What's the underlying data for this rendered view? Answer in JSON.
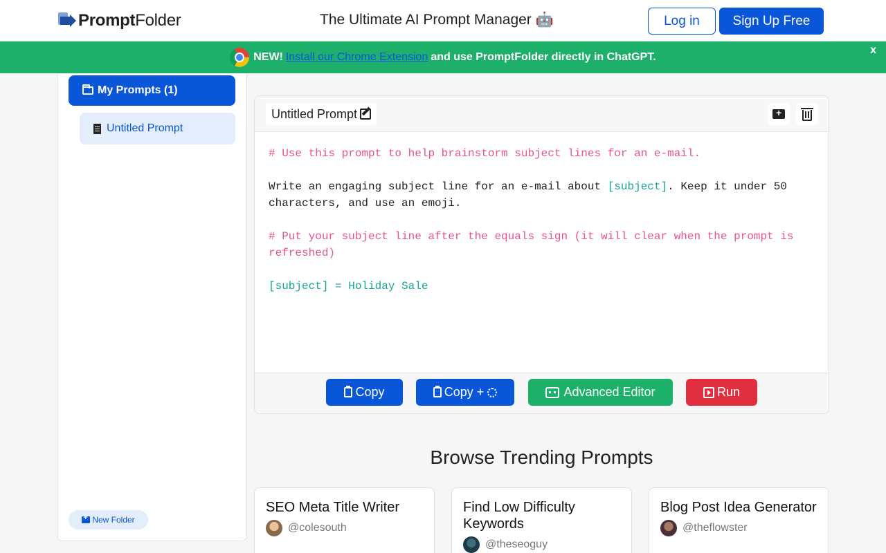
{
  "header": {
    "logo_bold": "Prompt",
    "logo_light": "Folder",
    "tagline": "The Ultimate AI Prompt Manager 🤖",
    "login_label": "Log in",
    "signup_label": "Sign Up Free"
  },
  "banner": {
    "prefix": "NEW!",
    "link_text": "Install our Chrome Extension",
    "suffix": "and use PromptFolder directly in ChatGPT.",
    "close_label": "x",
    "bg_color": "#1db06a"
  },
  "sidebar": {
    "folder_label": "My Prompts (1)",
    "prompt_label": "Untitled Prompt",
    "new_folder_label": "New Folder"
  },
  "editor": {
    "title": "Untitled Prompt",
    "lines": {
      "comment1": "# Use this prompt to help brainstorm subject lines for an e-mail.",
      "body_a": "Write an engaging subject line for an e-mail about ",
      "body_var": "[subject]",
      "body_b": ". Keep it under 50 characters, and use an emoji.",
      "comment2": "# Put your subject line after the equals sign (it will clear when the prompt is refreshed)",
      "assignment": "[subject] = Holiday Sale"
    },
    "buttons": {
      "copy": "Copy",
      "copy_plus": "Copy +",
      "advanced": "Advanced Editor",
      "run": "Run"
    }
  },
  "trending": {
    "title": "Browse Trending Prompts",
    "cards": [
      {
        "title": "SEO Meta Title Writer",
        "author": "@colesouth"
      },
      {
        "title": "Find Low Difficulty Keywords",
        "author": "@theseoguy"
      },
      {
        "title": "Blog Post Idea Generator",
        "author": "@theflowster"
      }
    ]
  },
  "colors": {
    "primary": "#0a56d9",
    "green": "#1db06a",
    "red": "#e03040",
    "comment": "#e8528f",
    "variable": "#14a394"
  }
}
